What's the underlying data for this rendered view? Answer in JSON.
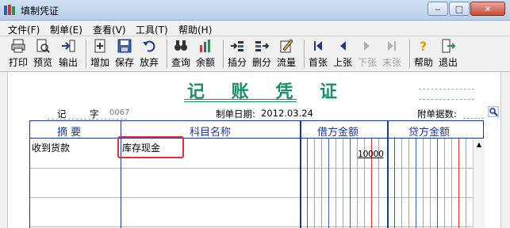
{
  "window": {
    "title": "填制凭证"
  },
  "menu": [
    {
      "label": "文件(F)"
    },
    {
      "label": "制单(E)"
    },
    {
      "label": "查看(V)"
    },
    {
      "label": "工具(T)"
    },
    {
      "label": "帮助(H)"
    }
  ],
  "toolbar": [
    {
      "label": "打印",
      "icon": "printer-icon",
      "enabled": true
    },
    {
      "label": "预览",
      "icon": "preview-icon",
      "enabled": true
    },
    {
      "label": "输出",
      "icon": "export-icon",
      "enabled": true
    },
    {
      "label": "增加",
      "icon": "add-icon",
      "enabled": true
    },
    {
      "label": "保存",
      "icon": "save-icon",
      "enabled": true
    },
    {
      "label": "放弃",
      "icon": "undo-icon",
      "enabled": true
    },
    {
      "label": "查询",
      "icon": "binoculars-icon",
      "enabled": true
    },
    {
      "label": "余额",
      "icon": "balance-chart-icon",
      "enabled": true
    },
    {
      "label": "插分",
      "icon": "insert-entry-icon",
      "enabled": true
    },
    {
      "label": "删分",
      "icon": "delete-entry-icon",
      "enabled": true
    },
    {
      "label": "流量",
      "icon": "cashflow-icon",
      "enabled": true
    },
    {
      "label": "首张",
      "icon": "first-icon",
      "enabled": true
    },
    {
      "label": "上张",
      "icon": "previous-icon",
      "enabled": true
    },
    {
      "label": "下张",
      "icon": "next-icon",
      "enabled": false
    },
    {
      "label": "末张",
      "icon": "last-icon",
      "enabled": false
    },
    {
      "label": "帮助",
      "icon": "help-icon",
      "enabled": true
    },
    {
      "label": "退出",
      "icon": "exit-icon",
      "enabled": true
    }
  ],
  "voucher": {
    "title": "记 账 凭 证",
    "type_label": "记",
    "zi_label": "字",
    "number": "0067",
    "date_label": "制单日期:",
    "date": "2012.03.24",
    "attachments_label": "附单据数:"
  },
  "table": {
    "headers": {
      "summary": "摘  要",
      "account": "科目名称",
      "debit": "借方金额",
      "credit": "贷方金额"
    },
    "rows": [
      {
        "summary": "收到货款",
        "account": "库存现金",
        "debit": "10000",
        "credit": ""
      }
    ]
  },
  "colors": {
    "title_green": "#1a8f6a",
    "grid_blue": "#1c3a8c",
    "highlight_red": "#e53030"
  }
}
